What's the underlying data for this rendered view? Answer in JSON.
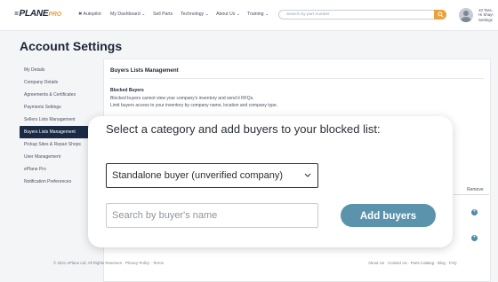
{
  "topnav": {
    "logo_main": "PLANE",
    "logo_pro": "PRO",
    "items": [
      "✖ Autopilot",
      "My Dashboard ⌄",
      "Sell Parts",
      "Technology ⌄",
      "About Us ⌄",
      "Training ⌄"
    ],
    "search_placeholder": "Search by part number",
    "user_lines": [
      "10 Tara..",
      "Hi Shay!",
      "Settings"
    ]
  },
  "page": {
    "title": "Account Settings"
  },
  "sidebar": {
    "items": [
      {
        "label": "My Details"
      },
      {
        "label": "Company Details"
      },
      {
        "label": "Agreements & Certificates"
      },
      {
        "label": "Payments Settings"
      },
      {
        "label": "Sellers Lists Management"
      },
      {
        "label": "Buyers Lists Management",
        "active": true
      },
      {
        "label": "Pickup Sites & Repair Shops"
      },
      {
        "label": "User Management"
      },
      {
        "label": "ePlane Pro"
      },
      {
        "label": "Notification Preferences"
      }
    ]
  },
  "main": {
    "section_title": "Buyers Lists Management",
    "blocked_heading": "Blocked Buyers",
    "blocked_line1": "Blocked buyers cannot view your company's inventory and send it RFQs.",
    "blocked_line2": "Limit buyers access to your inventory by company name, location and company type.",
    "remove_label": "Remove"
  },
  "modal": {
    "title": "Select a category and add buyers to your blocked list:",
    "category_value": "Standalone buyer (unverified company)",
    "name_placeholder": "Search by buyer's name",
    "add_button": "Add buyers"
  },
  "footer": {
    "left": "© 2021 ePlane Ltd. All Rights Reserves  ·  Privacy Policy  ·  Terms",
    "right": "About Us  ·  Contact Us  ·  Parts Catalog  ·  Blog  ·  FAQ"
  },
  "colors": {
    "accent": "#5b93ad",
    "nav_dark": "#1b2a44",
    "search_button": "#e9a23b"
  }
}
